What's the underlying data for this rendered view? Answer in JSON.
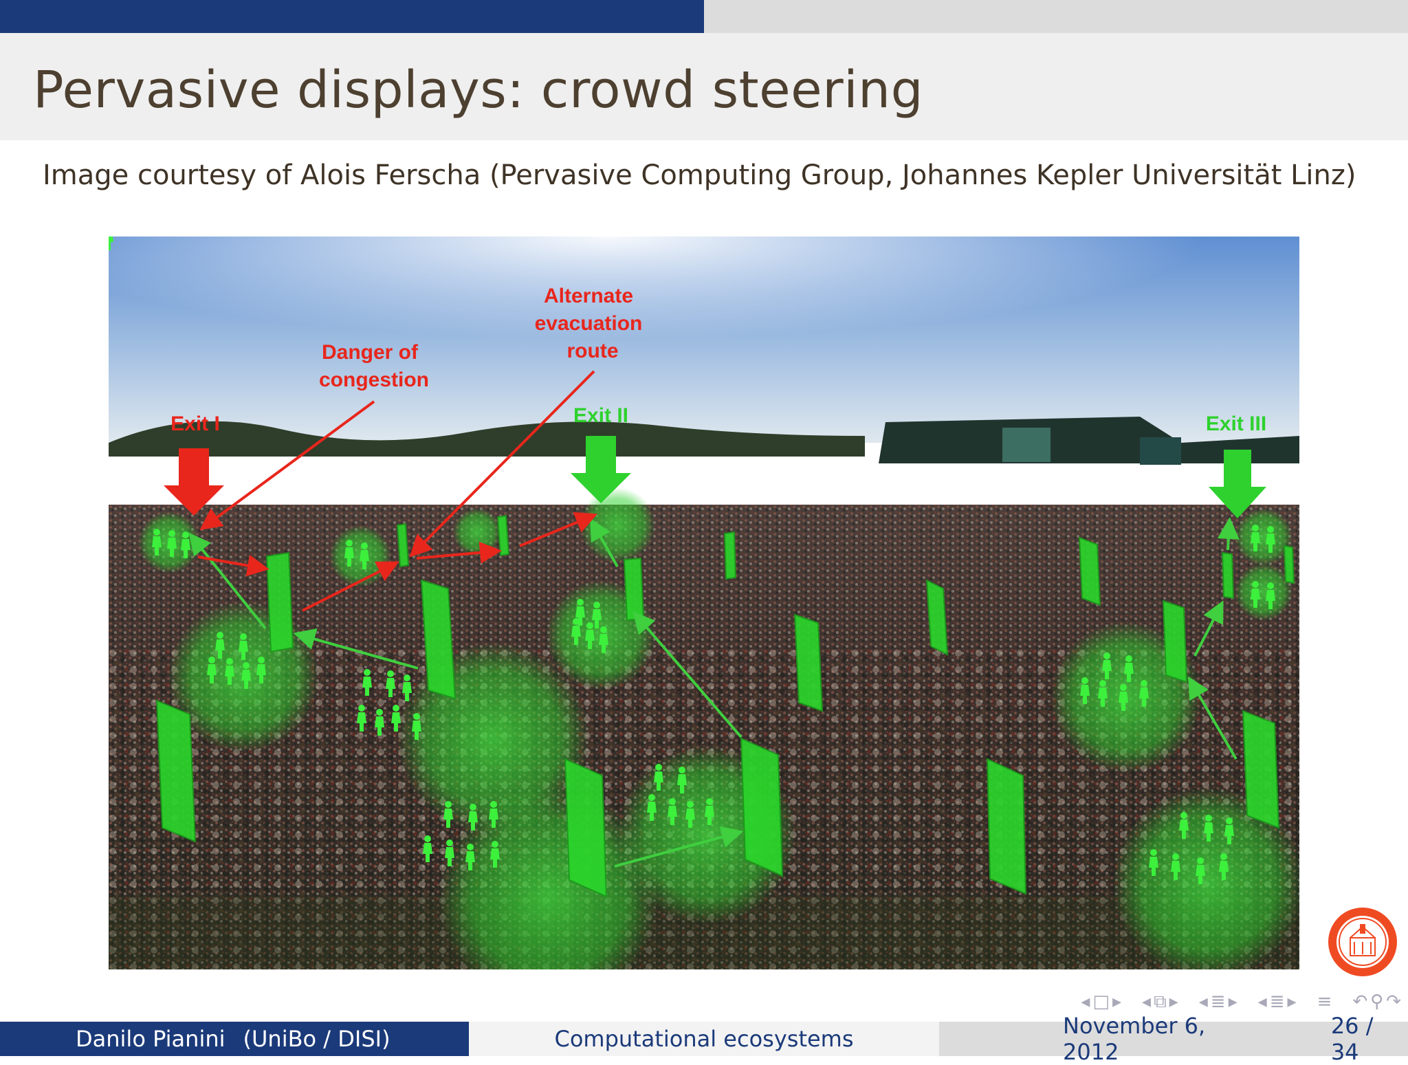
{
  "slide": {
    "title": "Pervasive displays: crowd steering",
    "caption": "Image courtesy of Alois Ferscha (Pervasive Computing Group, Johannes Kepler Universität Linz)",
    "progress": 0.5
  },
  "figure": {
    "labels": {
      "alternate": [
        "Alternate",
        "evacuation",
        "route"
      ],
      "danger": [
        "Danger of",
        "congestion"
      ],
      "exit1": "Exit I",
      "exit2": "Exit II",
      "exit3": "Exit III"
    },
    "colors": {
      "red": "#e8261c",
      "green": "#2ed12e",
      "sky_top": "#5f8fd2",
      "sky_bottom": "#dfe8ee"
    }
  },
  "navigation": {
    "icons": [
      "nav-frame-prev-icon",
      "nav-frame-icon",
      "nav-frame-next-icon",
      "nav-subsection-prev-icon",
      "nav-subsection-icon",
      "nav-subsection-next-icon",
      "nav-section-prev-icon",
      "nav-section-icon",
      "nav-section-next-icon",
      "nav-presentation-prev-icon",
      "nav-presentation-icon",
      "nav-presentation-next-icon",
      "nav-appendix-icon",
      "nav-undo-icon",
      "nav-search-icon",
      "nav-redo-icon"
    ]
  },
  "footer": {
    "author": "Danilo Pianini",
    "affiliation": "(UniBo / DISI)",
    "talk_title": "Computational ecosystems",
    "date": "November 6, 2012",
    "page": "26 / 34"
  }
}
